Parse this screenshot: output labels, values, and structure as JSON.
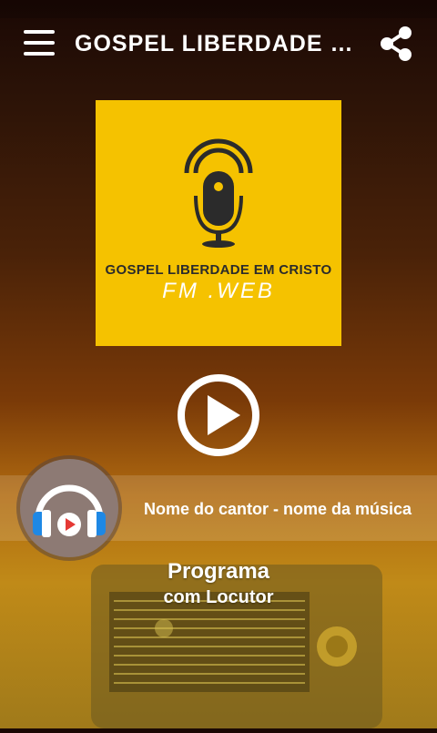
{
  "appbar": {
    "title": "GOSPEL LIBERDADE EM CRISTO FM .WEB",
    "menu_icon": "hamburger-menu-icon",
    "share_icon": "share-icon"
  },
  "logo": {
    "line1": "GOSPEL LIBERDADE EM CRISTO",
    "line2": "FM .WEB",
    "background": "#f5c200"
  },
  "player": {
    "play_icon": "play-icon",
    "now_playing": "Nome do cantor - nome da música",
    "headphones_icon": "headphones-icon"
  },
  "program": {
    "name": "Programa",
    "host": "com Locutor"
  },
  "colors": {
    "accent": "#f5c200",
    "headphone_blue": "#1e88e5",
    "play_red": "#e53935"
  }
}
